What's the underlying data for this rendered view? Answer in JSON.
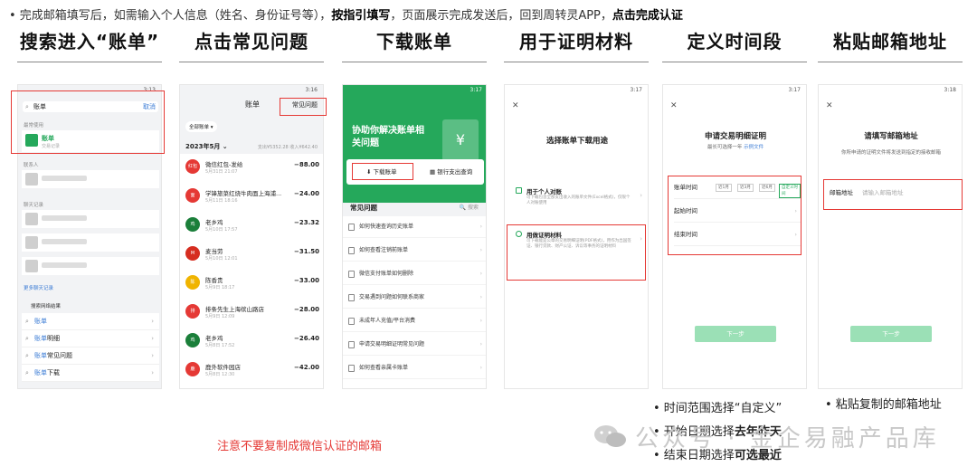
{
  "top_note": {
    "prefix": "• 完成邮箱填写后，如需输入个人信息（姓名、身份证号等），",
    "bold1": "按指引填写",
    "middle": "，页面展示完成发送后，回到周转灵APP，",
    "bold2": "点击完成认证"
  },
  "steps": [
    {
      "title": "搜索进入“账单”"
    },
    {
      "title": "点击常见问题"
    },
    {
      "title": "下载账单"
    },
    {
      "title": "用于证明材料"
    },
    {
      "title": "定义时间段"
    },
    {
      "title": "粘贴邮箱地址"
    }
  ],
  "phone1": {
    "status": "3:13",
    "search_value": "账单",
    "cancel": "取消",
    "recent_label": "最常使用",
    "card_title": "账单",
    "card_sub": "交易记录",
    "contacts_label": "联系人",
    "chat_label": "聊天记录",
    "more_chats": "更多聊天记录",
    "suggest_label": "搜索网络结果",
    "suggestions": [
      {
        "hl": "账单",
        "rest": ""
      },
      {
        "hl": "账单",
        "rest": "明细"
      },
      {
        "hl": "账单",
        "rest": "常见问题"
      },
      {
        "hl": "账单",
        "rest": "下载"
      }
    ]
  },
  "phone2": {
    "status": "3:16",
    "title": "账单",
    "faq": "常见问题",
    "filter": "全部账单 ▾",
    "month": "2023年5月 ⌄",
    "sum": "支出¥5352.28  收入¥642.40",
    "transactions": [
      {
        "name": "微信红包-发给",
        "date": "5月31日 21:07",
        "amount": "−88.00",
        "color": "#e53935",
        "logo": "红包"
      },
      {
        "name": "学锋旅菜红烧牛肉面上海浦...",
        "date": "5月11日 18:16",
        "amount": "−24.00",
        "color": "#e53935",
        "logo": "面"
      },
      {
        "name": "老乡鸡",
        "date": "5月10日 17:57",
        "amount": "−23.32",
        "color": "#1b7f3a",
        "logo": "鸡"
      },
      {
        "name": "麦当劳",
        "date": "5月10日 12:01",
        "amount": "−31.50",
        "color": "#d62d20",
        "logo": "M"
      },
      {
        "name": "陈香贵",
        "date": "5月9日 18:17",
        "amount": "−33.00",
        "color": "#f0b400",
        "logo": "陈"
      },
      {
        "name": "排条先生上海缤山路店",
        "date": "5月9日 12:09",
        "amount": "−28.00",
        "color": "#e53935",
        "logo": "排"
      },
      {
        "name": "老乡鸡",
        "date": "5月8日 17:52",
        "amount": "−26.40",
        "color": "#1b7f3a",
        "logo": "鸡"
      },
      {
        "name": "鹿外软件园店",
        "date": "5月8日 12:30",
        "amount": "−42.00",
        "color": "#e53935",
        "logo": "鹿"
      }
    ]
  },
  "phone3": {
    "status": "3:17",
    "title": "协助你解决账单相关问题",
    "doc_icon": "¥",
    "download_btn": "下载账单",
    "bank_btn": "银行支出查询",
    "section": "常见问题",
    "search": "🔍 搜索",
    "faqs": [
      "如何快速查询历史账单",
      "如何查看注销前账单",
      "微信支付账单如何删除",
      "交易遇到问题如何联系商家",
      "未成年人充值/平台消费",
      "申请交易明细证明常见问题",
      "如何查看亲属卡账单"
    ]
  },
  "phone4": {
    "status": "3:17",
    "title": "选择账单下载用途",
    "options": [
      {
        "title": "用于个人对账",
        "desc": "可下载包含全部支出收入的账单文件(Excel格式)，仅限个人对账使用"
      },
      {
        "title": "用做证明材料",
        "desc": "可下载能是公章的交易明细证明(PDF格式)，用作为出国签证、银行贷款、财产公证、诉讼等事务的证明材料"
      }
    ]
  },
  "phone5": {
    "status": "3:17",
    "title": "申请交易明细证明",
    "sub_prefix": "最长可选择一年 ",
    "sub_link": "示例文件",
    "rows": [
      {
        "label": "账单时间"
      },
      {
        "label": "起始时间"
      },
      {
        "label": "结束时间"
      }
    ],
    "chips": [
      "近1月",
      "近3月",
      "近6月",
      "自定义时间"
    ],
    "next": "下一步"
  },
  "phone6": {
    "status": "3:18",
    "title": "请填写邮箱地址",
    "sub": "你所申请的证明文件将发送到指定的接收邮箱",
    "email_label": "邮箱地址",
    "email_placeholder": "请输入邮箱地址",
    "next": "下一步"
  },
  "bullets_col5": [
    {
      "prefix": "• 时间范围选择“自定义”",
      "bold": ""
    },
    {
      "prefix": "• 开始日期选择",
      "bold": "去年昨天"
    },
    {
      "prefix": "• 结束日期选择",
      "bold": "可选最近"
    }
  ],
  "bullet_col6": "• 粘贴复制的邮箱地址",
  "warning": "注意不要复制成微信认证的邮箱",
  "watermark": "公众号 · 金企易融产品库",
  "colors": {
    "accent_green": "#25a85b",
    "highlight_red": "#e53935",
    "link_blue": "#3a7bd5"
  }
}
